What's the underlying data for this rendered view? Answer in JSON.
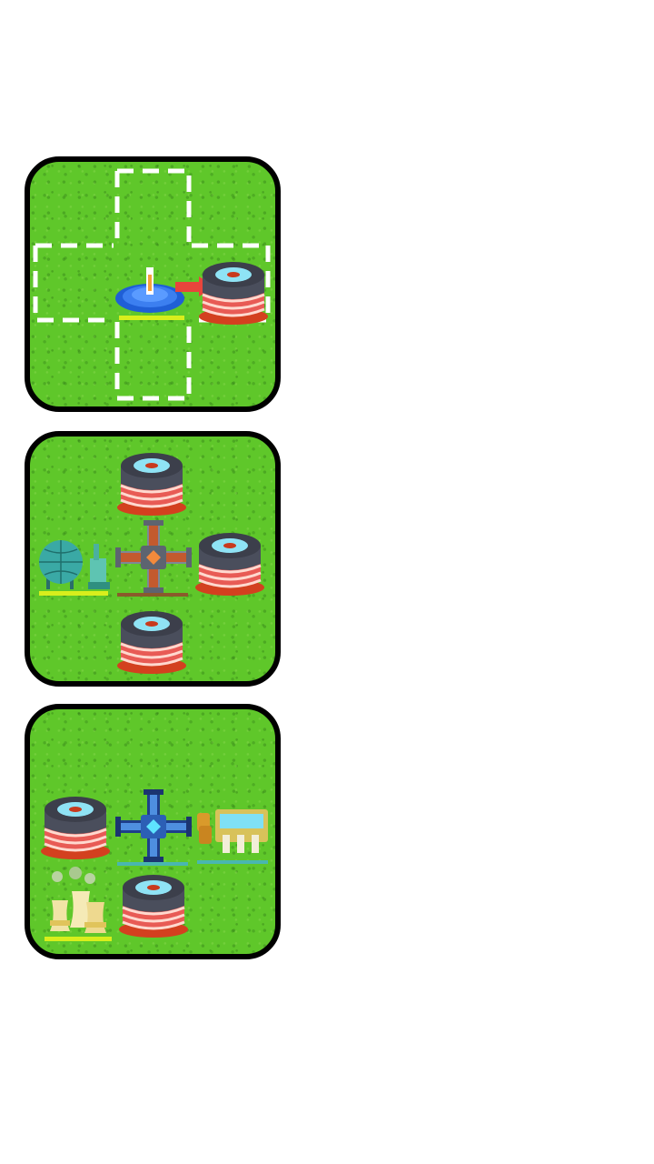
{
  "colors": {
    "grass": "#5fc72a",
    "border": "#000000",
    "dash_outline": "#ffffff",
    "arrow": "#e8453c",
    "underline_yellow": "#d8ee1c",
    "underline_brown": "#8a5a2b",
    "underline_teal": "#49b7b0"
  },
  "panels": [
    {
      "id": "panel-1",
      "cells": [
        "empty-slot",
        "empty-slot",
        "empty-slot",
        "empty-slot",
        "water-pump",
        "pipe-arrow",
        "storage-tank"
      ]
    },
    {
      "id": "panel-2",
      "cells": [
        "storage-tank",
        "gas-plant",
        "pipe-junction-copper",
        "storage-tank",
        "storage-tank"
      ]
    },
    {
      "id": "panel-3",
      "cells": [
        "storage-tank",
        "pipe-junction-blue",
        "water-treatment-plant",
        "cooling-towers",
        "storage-tank"
      ]
    }
  ]
}
